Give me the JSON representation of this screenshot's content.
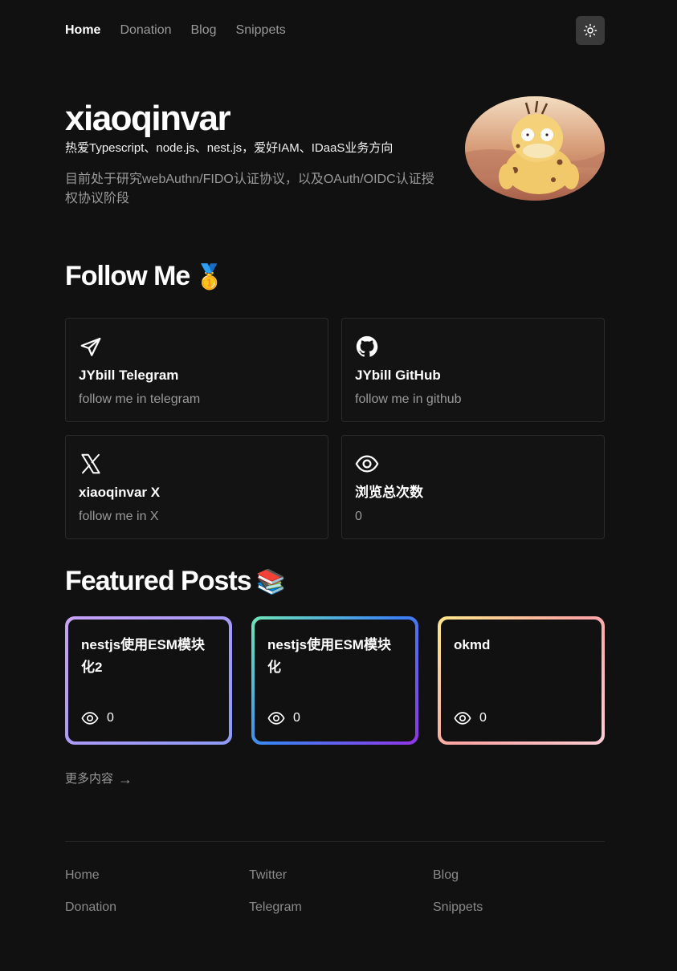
{
  "nav": {
    "items": [
      {
        "label": "Home",
        "active": true
      },
      {
        "label": "Donation",
        "active": false
      },
      {
        "label": "Blog",
        "active": false
      },
      {
        "label": "Snippets",
        "active": false
      }
    ],
    "theme_icon": "sun-icon"
  },
  "hero": {
    "name": "xiaoqinvar",
    "tagline": "热爱Typescript、node.js、nest.js，爱好IAM、IDaaS业务方向",
    "description": "目前处于研究webAuthn/FIDO认证协议，以及OAuth/OIDC认证授权协议阶段"
  },
  "follow": {
    "title": "Follow Me",
    "title_emoji": "🥇",
    "cards": [
      {
        "icon": "telegram-icon",
        "title": "JYbill Telegram",
        "subtitle": "follow me in telegram"
      },
      {
        "icon": "github-icon",
        "title": "JYbill GitHub",
        "subtitle": "follow me in github"
      },
      {
        "icon": "x-icon",
        "title": "xiaoqinvar X",
        "subtitle": "follow me in X"
      },
      {
        "icon": "eye-icon",
        "title": "浏览总次数",
        "subtitle": "0"
      }
    ]
  },
  "featured": {
    "title": "Featured Posts",
    "title_emoji": "📚",
    "posts": [
      {
        "title": "nestjs使用ESM模块化2",
        "views": "0"
      },
      {
        "title": "nestjs使用ESM模块化",
        "views": "0"
      },
      {
        "title": "okmd",
        "views": "0"
      }
    ],
    "more_label": "更多内容",
    "more_arrow": "→"
  },
  "footer": {
    "links": [
      "Home",
      "Twitter",
      "Blog",
      "Donation",
      "Telegram",
      "Snippets"
    ]
  }
}
